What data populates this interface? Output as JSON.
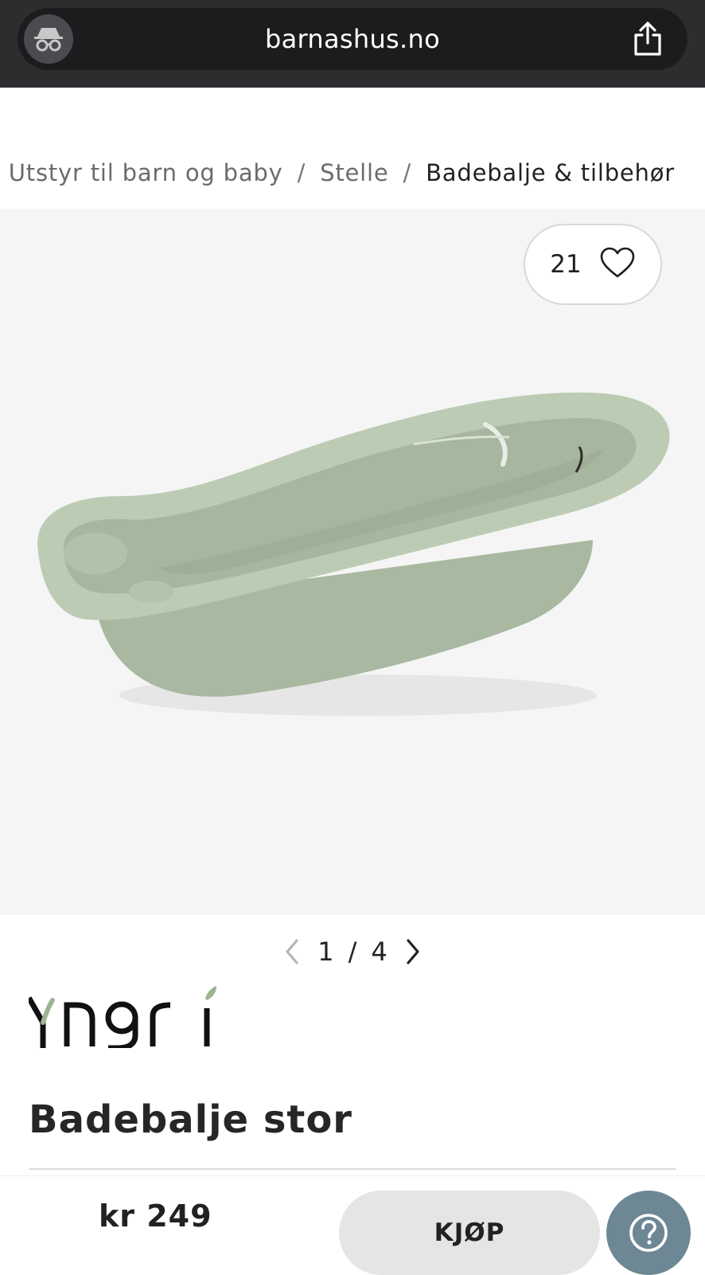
{
  "browser": {
    "url": "barnashus.no",
    "incognito_icon": "incognito-icon",
    "share_icon": "share-icon"
  },
  "breadcrumb": {
    "items": [
      "Utstyr til barn og baby",
      "Stelle",
      "Badebalje & tilbehør"
    ],
    "separator": "/"
  },
  "gallery": {
    "favorite_count": "21",
    "favorite_icon": "heart-icon",
    "current": "1",
    "separator": "/",
    "total": "4",
    "prev_icon": "chevron-left-icon",
    "next_icon": "chevron-right-icon"
  },
  "product": {
    "brand": "Yngri",
    "title": "Badebalje stor"
  },
  "bottom_bar": {
    "price": "kr 249",
    "buy_label": "KJØP",
    "help_icon": "help-icon"
  },
  "colors": {
    "topbar": "#2c2d2f",
    "image_bg": "#f5f5f5",
    "tub": "#b6c4ad",
    "buy_button": "#e5e5e5",
    "help_button": "#6d8795"
  }
}
